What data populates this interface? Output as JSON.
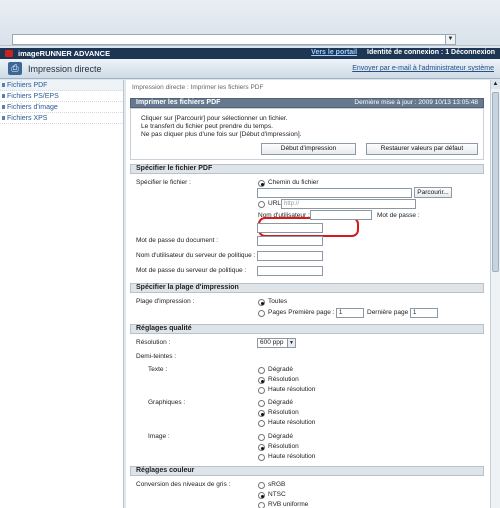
{
  "browser": {
    "address_dropdown": "▼"
  },
  "header": {
    "brand": "imageRUNNER ADVANCE",
    "portal_link": "Vers le portail",
    "login_info": "Identité de connexion : 1 Déconnexion",
    "page_title": "Impression directe",
    "email_link": "Envoyer par e-mail à l'administrateur système"
  },
  "sidebar": {
    "items": [
      {
        "label": "Fichiers PDF"
      },
      {
        "label": "Fichiers PS/EPS"
      },
      {
        "label": "Fichiers d'image"
      },
      {
        "label": "Fichiers XPS"
      }
    ]
  },
  "breadcrumb": "Impression directe : Imprimer les fichiers PDF",
  "print_section": {
    "title": "Imprimer les fichiers PDF",
    "last_update": "Dernière mise à jour : 2009 10/13 13:05:48",
    "messages": [
      "Cliquer sur [Parcourir] pour sélectionner un fichier.",
      "Le transfert du fichier peut prendre du temps.",
      "Ne pas cliquer plus d'une fois sur [Début d'impression]."
    ],
    "start_button": "Début d'impression",
    "reset_button": "Restaurer valeurs par défaut"
  },
  "file_section": {
    "title": "Spécifier le fichier PDF",
    "file_label": "Spécifier le fichier :",
    "path_radio": "Chemin du fichier",
    "browse_button": "Parcourir...",
    "url_radio": "URL",
    "url_placeholder": "http://",
    "username_label": "Nom d'utilisateur :",
    "password_label": "Mot de passe :",
    "doc_password_label": "Mot de passe du document :",
    "policy_user_label": "Nom d'utilisateur du serveur de politique :",
    "policy_password_label": "Mot de passe du serveur de politique :"
  },
  "range_section": {
    "title": "Spécifier la plage d'impression",
    "range_label": "Plage d'impression :",
    "all_radio": "Toutes",
    "pages_radio": "Pages Première page :",
    "first_page_value": "1",
    "last_page_label": "Dernière page :",
    "last_page_value": "1"
  },
  "quality_section": {
    "title": "Réglages qualité",
    "resolution_label": "Résolution :",
    "resolution_value": "600 ppp",
    "halftone_label": "Demi-teintes :",
    "text_label": "Texte :",
    "graphics_label": "Graphiques :",
    "image_label": "Image :",
    "options": {
      "degrade": "Dégradé",
      "resolution": "Résolution",
      "high_resolution": "Haute résolution"
    }
  },
  "color_section": {
    "title": "Réglages couleur",
    "gray_label": "Conversion des niveaux de gris :",
    "options": [
      "sRGB",
      "NTSC",
      "RVB uniforme"
    ]
  },
  "colors": {
    "accent": "#1d3654",
    "highlight": "#d41a1a",
    "link": "#2a5b96"
  }
}
